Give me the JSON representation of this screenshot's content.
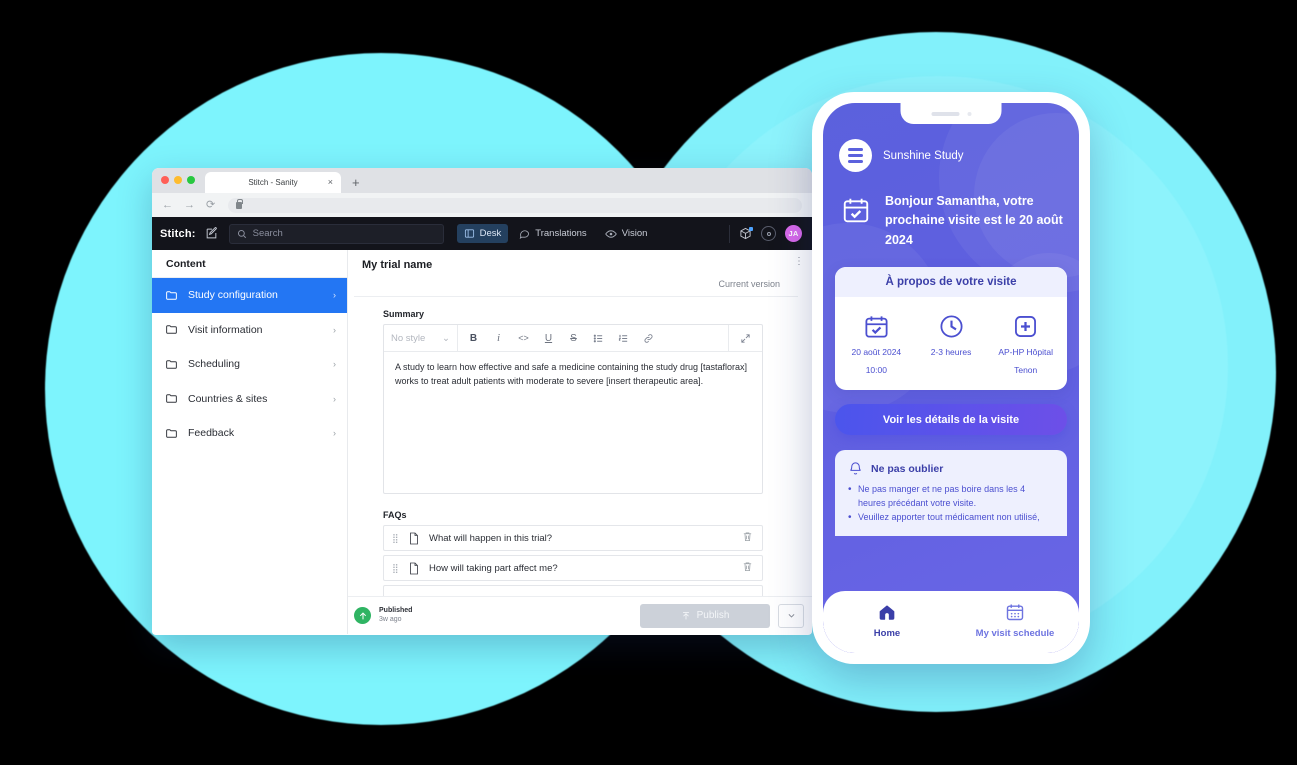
{
  "browser": {
    "tab_title": "Stitch - Sanity",
    "tab_close": "×",
    "new_tab": "+",
    "back_icon": "←",
    "forward_icon": "→",
    "reload_icon": "⟳"
  },
  "sanity": {
    "brand": "Stitch:",
    "search_placeholder": "Search",
    "nav": [
      {
        "label": "Desk",
        "active": true
      },
      {
        "label": "Translations",
        "active": false
      },
      {
        "label": "Vision",
        "active": false
      }
    ],
    "avatar_initials": "JA",
    "sidebar": {
      "heading": "Content",
      "items": [
        {
          "label": "Study configuration",
          "active": true
        },
        {
          "label": "Visit information",
          "active": false
        },
        {
          "label": "Scheduling",
          "active": false
        },
        {
          "label": "Countries & sites",
          "active": false
        },
        {
          "label": "Feedback",
          "active": false
        }
      ],
      "chevron": "›"
    },
    "document": {
      "title": "My trial name",
      "version": "Current version",
      "kebab": "⋮",
      "summary_label": "Summary",
      "editor": {
        "style_value": "No style",
        "style_caret": "⌄",
        "buttons": [
          {
            "name": "bold",
            "glyph": "B"
          },
          {
            "name": "italic",
            "glyph": "i"
          },
          {
            "name": "code",
            "glyph": "‹›"
          },
          {
            "name": "underline",
            "glyph": "U"
          },
          {
            "name": "strikethrough",
            "glyph": "S"
          },
          {
            "name": "bulleted-list",
            "glyph": "☰"
          },
          {
            "name": "numbered-list",
            "glyph": "☰"
          },
          {
            "name": "link",
            "glyph": "🔗"
          }
        ],
        "expand_glyph": "⤡"
      },
      "summary_text": "A study to learn how effective and safe a medicine containing the study drug [tastaflorax] works to treat adult patients with moderate to severe [insert therapeutic area].",
      "faqs_label": "FAQs",
      "faqs": [
        {
          "question": "What will happen in this trial?"
        },
        {
          "question": "How will taking part affect me?"
        }
      ],
      "grip_glyph": "⁙"
    },
    "footer": {
      "status_title": "Published",
      "status_time": "3w ago",
      "publish_label": "Publish",
      "publish_icon": "⤒",
      "caret": "⌄"
    }
  },
  "phone": {
    "brand": "Sunshine Study",
    "greeting": "Bonjour Samantha, votre prochaine visite est le 20 août 2024",
    "card_title": "À propos de votre visite",
    "info": [
      {
        "icon": "calendar-check-icon",
        "label": "20 août 2024\n10:00"
      },
      {
        "icon": "clock-icon",
        "label": "2-3 heures"
      },
      {
        "icon": "hospital-cross-icon",
        "label": "AP-HP Hôpital Tenon"
      }
    ],
    "cta_label": "Voir les détails de la visite",
    "reminder_title": "Ne pas oublier",
    "reminders": [
      "Ne pas manger et ne pas boire dans les 4 heures précédant votre visite.",
      "Veuillez apporter tout médicament non utilisé,"
    ],
    "tabs": [
      {
        "label": "Home",
        "icon": "home-icon",
        "active": true
      },
      {
        "label": "My visit schedule",
        "icon": "calendar-icon",
        "active": false
      }
    ]
  },
  "colors": {
    "accent_blue": "#2376f3",
    "phone_purple": "#5b61dd",
    "cta_gradient_start": "#4b55ec",
    "cta_gradient_end": "#6d4fe8",
    "blob_cyan": "#82f1fb",
    "blob_ring_blue": "#4f7cf5",
    "published_green": "#2fb463",
    "avatar_magenta": "#d869ea"
  }
}
